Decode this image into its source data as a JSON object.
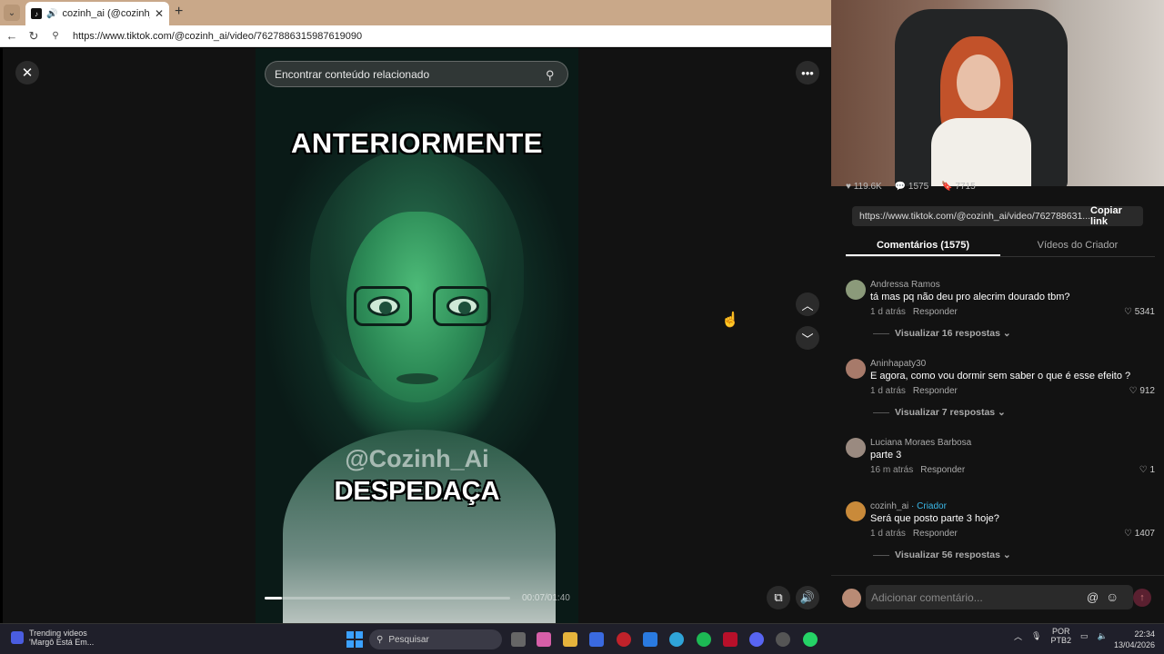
{
  "browser": {
    "tab_title": "cozinh_ai (@cozinh_ai) | TikTo",
    "url": "https://www.tiktok.com/@cozinh_ai/video/7627886315987619090"
  },
  "video": {
    "search_placeholder": "Encontrar conteúdo relacionado",
    "caption_top": "ANTERIORMENTE",
    "watermark": "@Cozinh_Ai",
    "caption_bottom": "DESPEDAÇA",
    "timecode": "00:07/01:40",
    "progress_fraction": 0.07
  },
  "panel": {
    "stats": [
      "119.6K",
      "1575",
      "7715"
    ],
    "share_link": "https://www.tiktok.com/@cozinh_ai/video/762788631...",
    "copy_link_label": "Copiar link",
    "tabs": [
      "Comentários (1575)",
      "Vídeos do Criador"
    ],
    "comments": [
      {
        "author": "Andressa Ramos",
        "creator_tag": "",
        "text": "tá mas pq não deu pro alecrim dourado tbm?",
        "time": "1 d atrás",
        "reply": "Responder",
        "likes": "5341",
        "view_replies": "Visualizar 16 respostas"
      },
      {
        "author": "Aninhapaty30",
        "creator_tag": "",
        "text": "E agora, como vou dormir sem saber o que é esse efeito ?",
        "time": "1 d atrás",
        "reply": "Responder",
        "likes": "912",
        "view_replies": "Visualizar 7 respostas"
      },
      {
        "author": "Luciana Moraes Barbosa",
        "creator_tag": "",
        "text": "parte 3",
        "time": "16 m atrás",
        "reply": "Responder",
        "likes": "1",
        "view_replies": ""
      },
      {
        "author": "cozinh_ai",
        "creator_tag": " · Criador",
        "text": "Será que posto parte 3 hoje?",
        "time": "1 d atrás",
        "reply": "Responder",
        "likes": "1407",
        "view_replies": "Visualizar 56 respostas"
      }
    ],
    "comment_placeholder": "Adicionar comentário..."
  },
  "taskbar": {
    "widget_title": "Trending videos",
    "widget_subtitle": "'Margô Está Em...",
    "search_label": "Pesquisar",
    "lang_top": "POR",
    "lang_bottom": "PTB2",
    "time": "22:34",
    "date": "13/04/2026"
  }
}
